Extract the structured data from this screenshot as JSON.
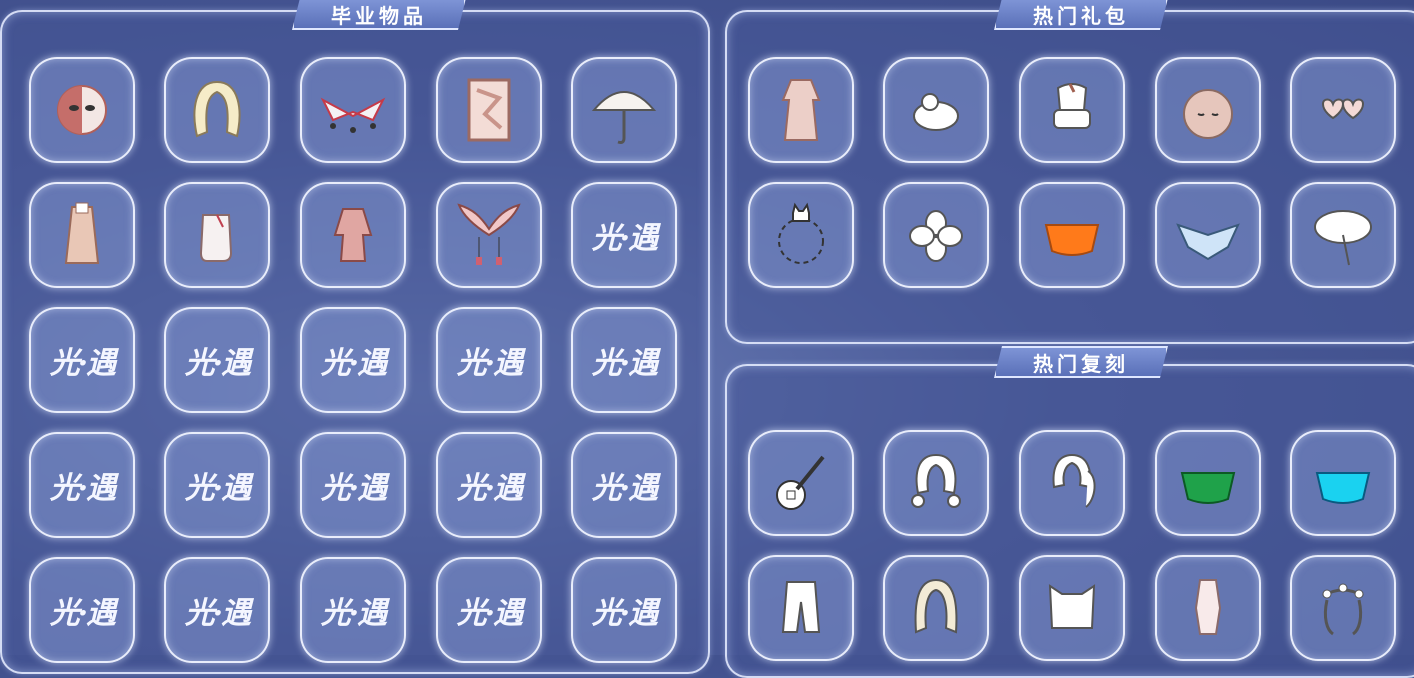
{
  "sections": {
    "graduation": {
      "title": "毕业物品"
    },
    "gifts": {
      "title": "热门礼包"
    },
    "rerun": {
      "title": "热门复刻"
    }
  },
  "placeholder_logo": "光·遇",
  "graduation_items": [
    {
      "icon": "mask-icon"
    },
    {
      "icon": "long-hair-icon"
    },
    {
      "icon": "cape-ornament-icon"
    },
    {
      "icon": "card-icon"
    },
    {
      "icon": "umbrella-icon"
    },
    {
      "icon": "cape-icon"
    },
    {
      "icon": "boots-icon"
    },
    {
      "icon": "outfit-icon"
    },
    {
      "icon": "wings-headpiece-icon"
    },
    {
      "icon": "locked-placeholder-icon"
    }
  ],
  "gift_items": [
    {
      "icon": "robe-icon"
    },
    {
      "icon": "cloud-prop-icon"
    },
    {
      "icon": "hat-icon"
    },
    {
      "icon": "face-mask-icon"
    },
    {
      "icon": "heart-glasses-icon"
    },
    {
      "icon": "cat-halo-icon"
    },
    {
      "icon": "clover-icon"
    },
    {
      "icon": "orange-cape-icon"
    },
    {
      "icon": "blue-cape-icon"
    },
    {
      "icon": "leaf-umbrella-icon"
    }
  ],
  "rerun_items": [
    {
      "icon": "guitar-icon"
    },
    {
      "icon": "twin-bun-hair-icon"
    },
    {
      "icon": "ponytail-hair-icon"
    },
    {
      "icon": "green-cape-icon"
    },
    {
      "icon": "cyan-cape-icon"
    },
    {
      "icon": "pants-icon"
    },
    {
      "icon": "wavy-hair-icon"
    },
    {
      "icon": "cat-ear-hair-icon"
    },
    {
      "icon": "small-outfit-icon"
    },
    {
      "icon": "flower-crown-icon"
    }
  ]
}
